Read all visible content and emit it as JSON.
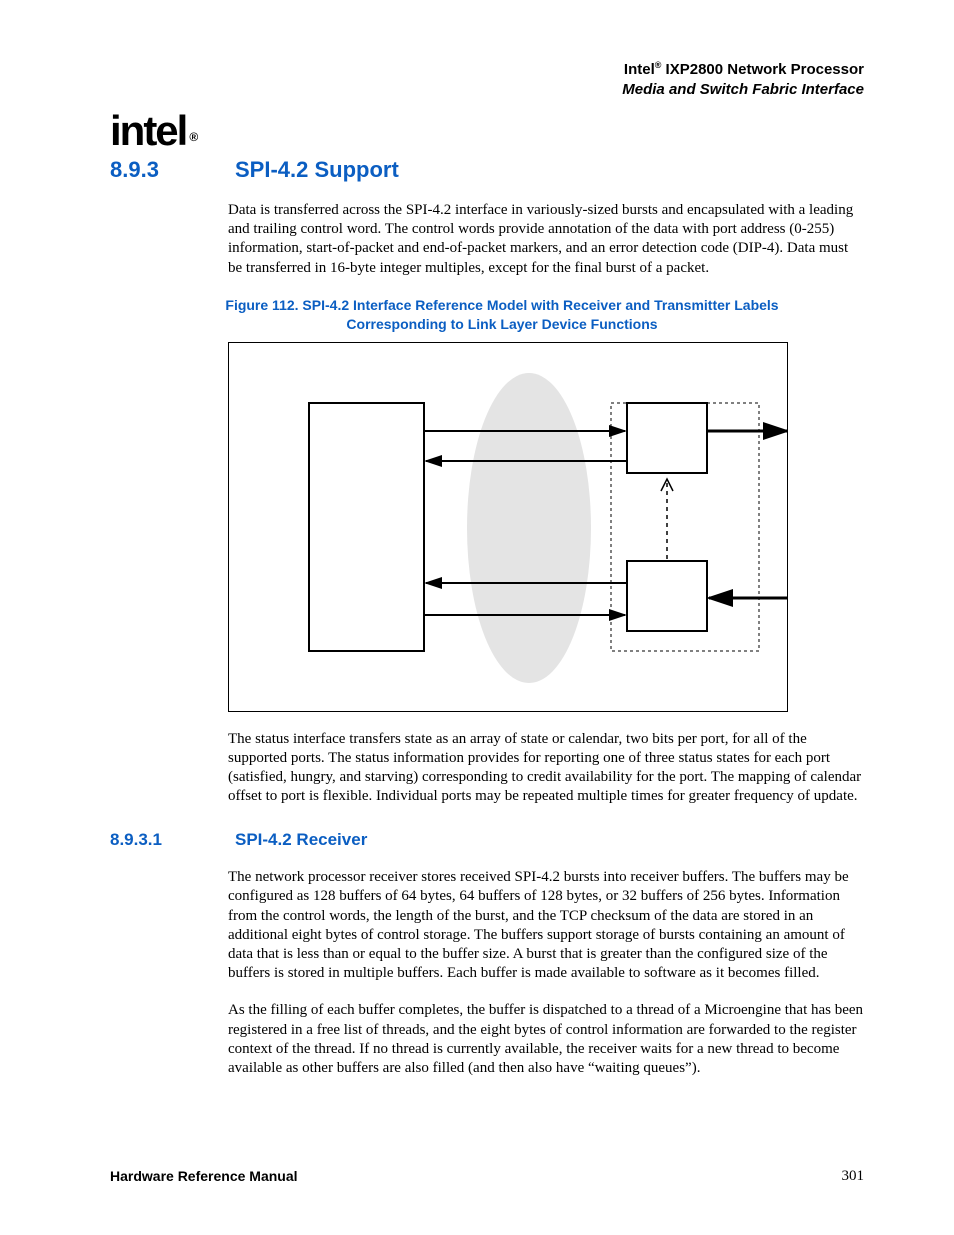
{
  "header": {
    "product_prefix": "Intel",
    "product_suffix": " IXP2800 Network Processor",
    "reg": "®",
    "subtitle": "Media and Switch Fabric Interface"
  },
  "logo": {
    "text": "intel",
    "reg": "®"
  },
  "section": {
    "num": "8.9.3",
    "title": "SPI-4.2 Support"
  },
  "p1": "Data is transferred across the SPI-4.2 interface in variously-sized bursts and encapsulated with a leading and trailing control word. The control words provide annotation of the data with port address (0-255) information, start-of-packet and end-of-packet markers, and an error detection code (DIP-4). Data must be transferred in 16-byte integer multiples, except for the final burst of a packet.",
  "figure": {
    "label": "Figure 112. SPI-4.2 Interface Reference Model with Receiver and Transmitter Labels Corresponding to Link Layer Device Functions"
  },
  "p2": "The status interface transfers state as an array of state or calendar, two bits per port, for all of the supported ports. The status information provides for reporting one of three status states for each port (satisfied, hungry, and starving) corresponding to credit availability for the port. The mapping of calendar offset to port is flexible. Individual ports may be repeated multiple times for greater frequency of update.",
  "subsection": {
    "num": "8.9.3.1",
    "title": "SPI-4.2 Receiver"
  },
  "p3": "The network processor receiver stores received SPI-4.2 bursts into receiver buffers. The buffers may be configured as 128 buffers of 64 bytes, 64 buffers of 128 bytes, or 32 buffers of 256 bytes. Information from the control words, the length of the burst, and the TCP checksum of the data are stored in an additional eight bytes of control storage. The buffers support storage of bursts containing an amount of data that is less than or equal to the buffer size. A burst that is greater than the configured size of the buffers is stored in multiple buffers. Each buffer is made available to software as it becomes filled.",
  "p4": "As the filling of each buffer completes, the buffer is dispatched to a thread of a Microengine that has been registered in a free list of threads, and the eight bytes of control information are forwarded to the register context of the thread. If no thread is currently available, the receiver waits for a new thread to become available as other buffers are also filled (and then also have “waiting queues”).",
  "footer": {
    "manual": "Hardware Reference Manual",
    "page": "301"
  }
}
